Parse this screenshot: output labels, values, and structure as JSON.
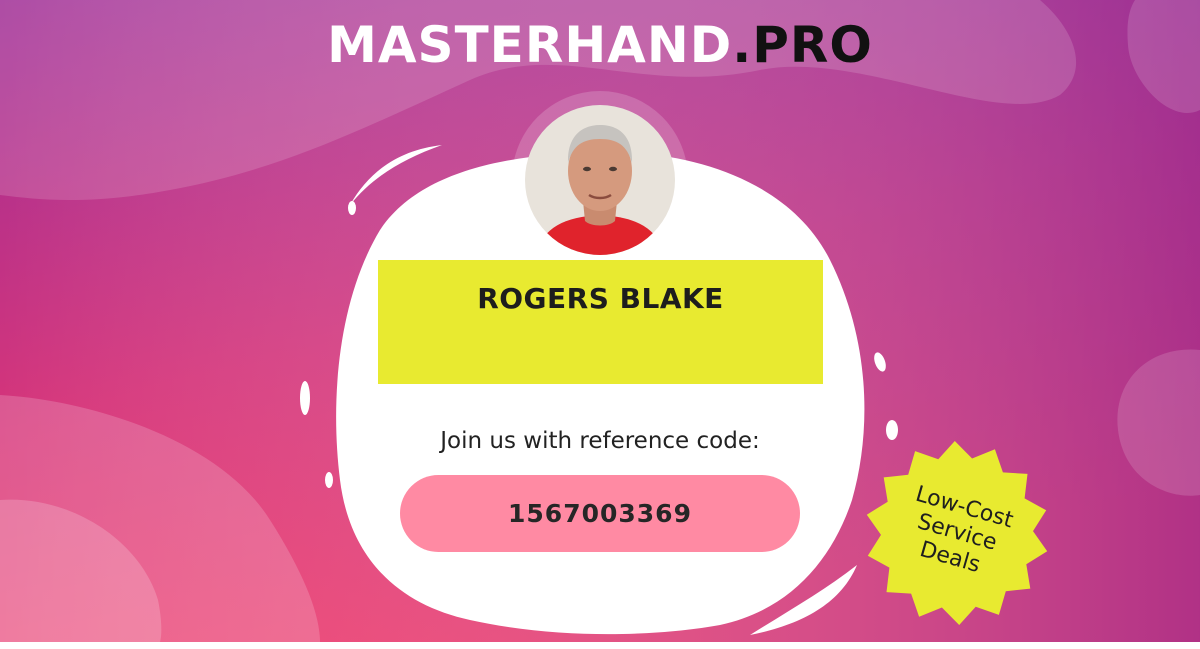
{
  "brand": {
    "name": "MASTERHAND",
    "tld": ".PRO"
  },
  "profile": {
    "avatar": "profile-photo",
    "name": "ROGERS BLAKE"
  },
  "referral": {
    "label": "Join us with reference code:",
    "code": "1567003369"
  },
  "badge": {
    "lines": [
      "Low-Cost",
      "Service",
      "Deals"
    ]
  },
  "colors": {
    "gradient_top": "#9c2e95",
    "gradient_bottom": "#f03a6a",
    "name_band": "#e8ea30",
    "code_pill": "#ff8aa3",
    "badge": "#e8ea30"
  }
}
